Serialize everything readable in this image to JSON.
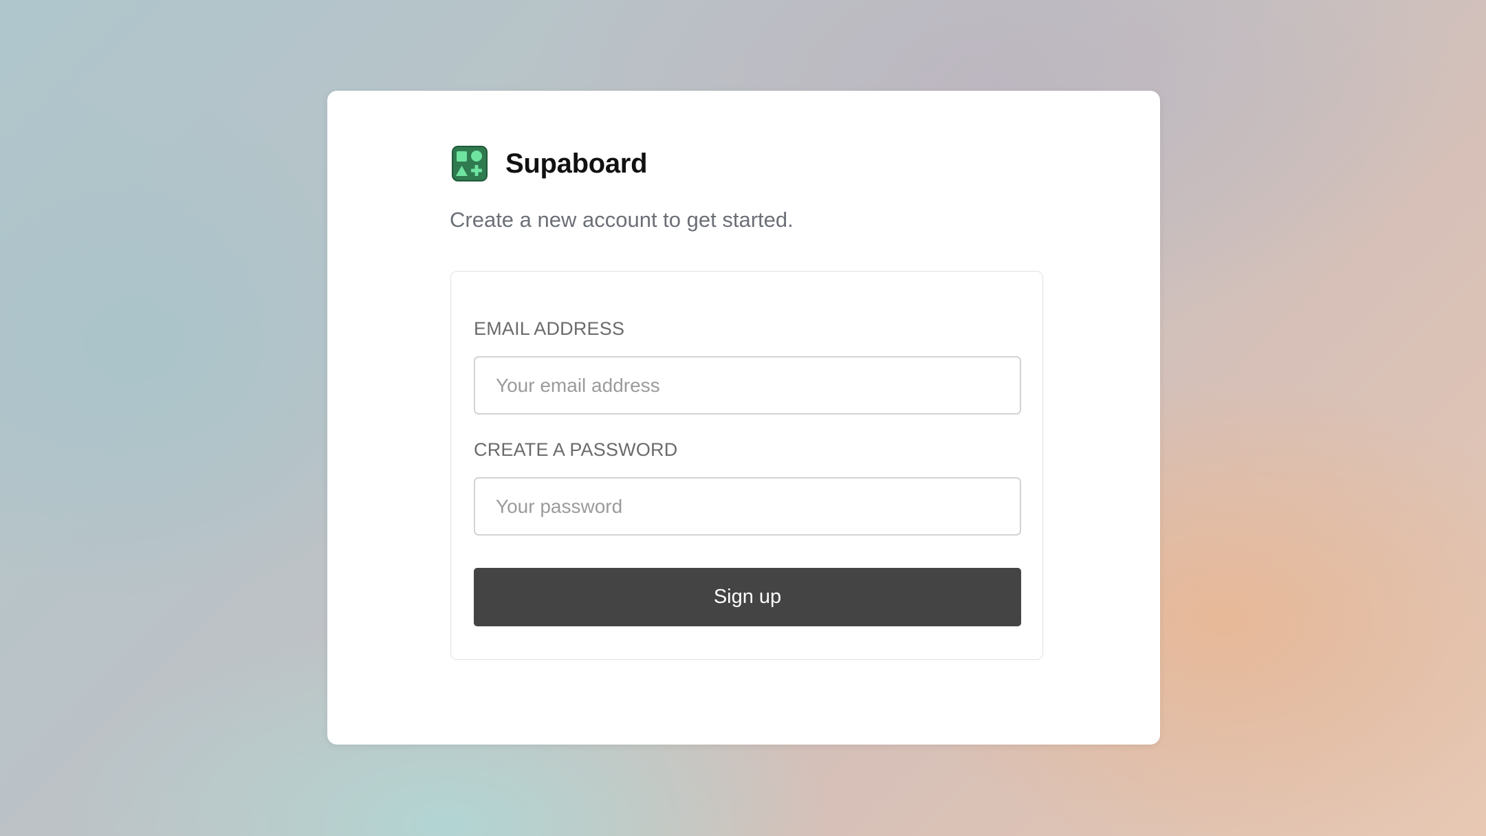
{
  "brand": {
    "name": "Supaboard",
    "logo_icon": "shapes-icon",
    "logo_color": "#3ecf8e"
  },
  "subtitle": "Create a new account to get started.",
  "form": {
    "email": {
      "label": "EMAIL ADDRESS",
      "placeholder": "Your email address",
      "value": ""
    },
    "password": {
      "label": "CREATE A PASSWORD",
      "placeholder": "Your password",
      "value": ""
    },
    "submit_label": "Sign up",
    "submit_color": "#444444"
  }
}
